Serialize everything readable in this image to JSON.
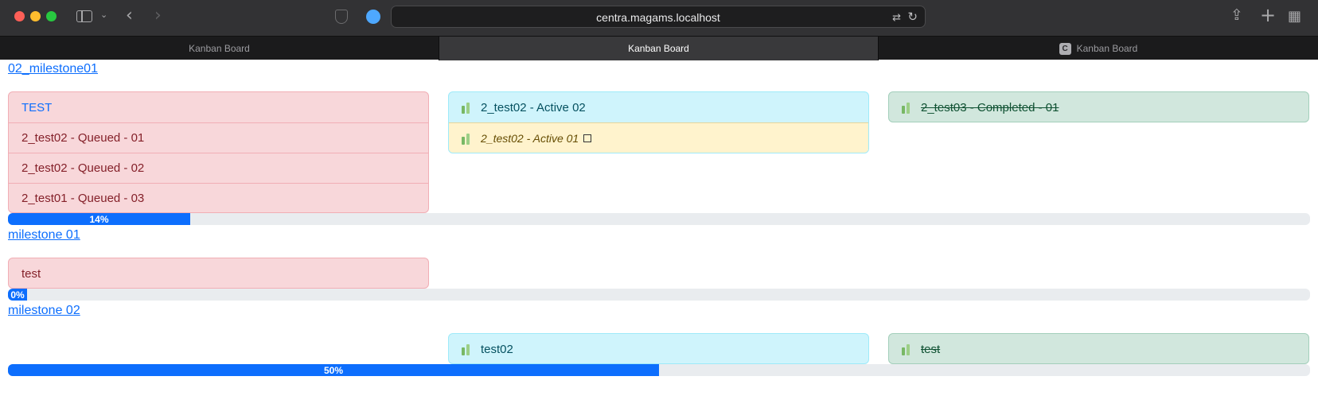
{
  "browser": {
    "url": "centra.magams.localhost",
    "tabs": [
      {
        "label": "Kanban Board",
        "active": false
      },
      {
        "label": "Kanban Board",
        "active": true
      },
      {
        "label": "Kanban Board",
        "active": false,
        "favicon": "C"
      }
    ]
  },
  "milestones": [
    {
      "title": "02_milestone01",
      "queued": {
        "header": "TEST",
        "items": [
          "2_test02 - Queued - 01",
          "2_test02 - Queued - 02",
          "2_test01 - Queued - 03"
        ]
      },
      "active": {
        "items": [
          "2_test02 - Active 02"
        ],
        "sub_item": "2_test02 - Active 01"
      },
      "completed": {
        "items": [
          "2_test03 - Completed - 01"
        ]
      },
      "progress": {
        "value": 14,
        "label": "14%"
      }
    },
    {
      "title": "milestone 01",
      "queued": {
        "items": [
          "test"
        ]
      },
      "progress": {
        "value": 0,
        "label": "0%"
      }
    },
    {
      "title": "milestone 02",
      "active": {
        "items": [
          "test02"
        ]
      },
      "completed": {
        "items": [
          "test"
        ]
      },
      "progress": {
        "value": 50,
        "label": "50%"
      }
    }
  ],
  "colors": {
    "primary": "#0d6efd",
    "queued_bg": "#f8d7da",
    "active_bg": "#cff4fc",
    "completed_bg": "#d1e7dd",
    "highlight_bg": "#fff3cd"
  }
}
